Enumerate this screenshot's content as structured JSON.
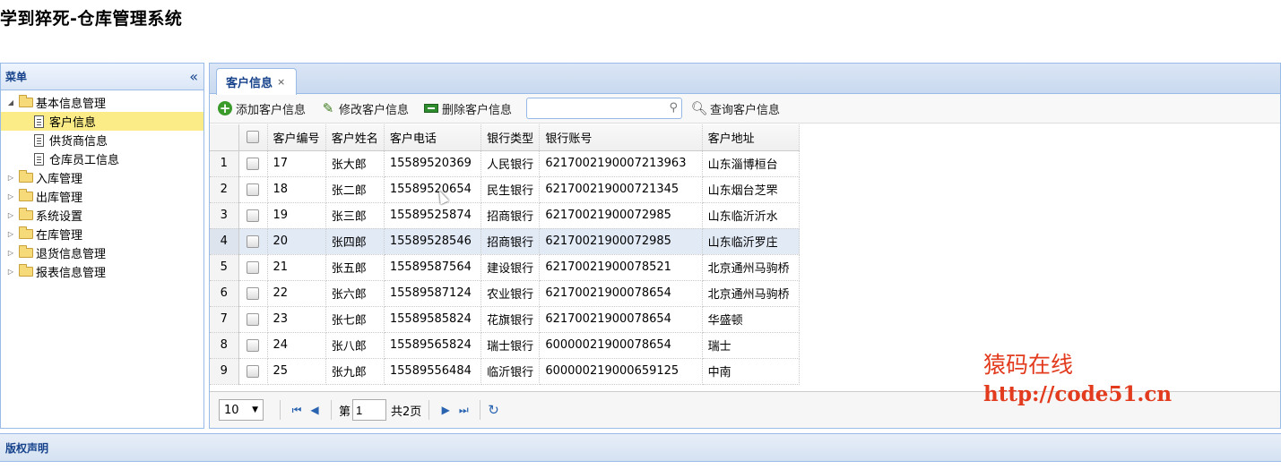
{
  "app": {
    "title": "学到猝死-仓库管理系统"
  },
  "menu": {
    "title": "菜单",
    "collapse_icon": "«",
    "items": [
      {
        "label": "基本信息管理",
        "type": "folder",
        "expanded": true,
        "level": 0
      },
      {
        "label": "客户信息",
        "type": "file",
        "selected": true,
        "level": 1
      },
      {
        "label": "供货商信息",
        "type": "file",
        "level": 1
      },
      {
        "label": "仓库员工信息",
        "type": "file",
        "level": 1
      },
      {
        "label": "入库管理",
        "type": "folder",
        "level": 0
      },
      {
        "label": "出库管理",
        "type": "folder",
        "level": 0
      },
      {
        "label": "系统设置",
        "type": "folder",
        "level": 0
      },
      {
        "label": "在库管理",
        "type": "folder",
        "level": 0
      },
      {
        "label": "退货信息管理",
        "type": "folder",
        "level": 0
      },
      {
        "label": "报表信息管理",
        "type": "folder",
        "level": 0
      }
    ]
  },
  "tab": {
    "label": "客户信息",
    "close": "×"
  },
  "toolbar": {
    "add_label": "添加客户信息",
    "edit_label": "修改客户信息",
    "delete_label": "删除客户信息",
    "search_placeholder": "",
    "query_label": "查询客户信息"
  },
  "grid": {
    "columns": [
      "客户编号",
      "客户姓名",
      "客户电话",
      "银行类型",
      "银行账号",
      "客户地址"
    ],
    "rows": [
      {
        "num": "1",
        "id": "17",
        "name": "张大郎",
        "phone": "15589520369",
        "bank": "人民银行",
        "account": "6217002190007213963",
        "address": "山东淄博桓台"
      },
      {
        "num": "2",
        "id": "18",
        "name": "张二郎",
        "phone": "15589520654",
        "bank": "民生银行",
        "account": "621700219000721345",
        "address": "山东烟台芝罘"
      },
      {
        "num": "3",
        "id": "19",
        "name": "张三郎",
        "phone": "15589525874",
        "bank": "招商银行",
        "account": "62170021900072985",
        "address": "山东临沂沂水"
      },
      {
        "num": "4",
        "id": "20",
        "name": "张四郎",
        "phone": "15589528546",
        "bank": "招商银行",
        "account": "62170021900072985",
        "address": "山东临沂罗庄"
      },
      {
        "num": "5",
        "id": "21",
        "name": "张五郎",
        "phone": "15589587564",
        "bank": "建设银行",
        "account": "62170021900078521",
        "address": "北京通州马驹桥"
      },
      {
        "num": "6",
        "id": "22",
        "name": "张六郎",
        "phone": "15589587124",
        "bank": "农业银行",
        "account": "62170021900078654",
        "address": "北京通州马驹桥"
      },
      {
        "num": "7",
        "id": "23",
        "name": "张七郎",
        "phone": "15589585824",
        "bank": "花旗银行",
        "account": "62170021900078654",
        "address": "华盛顿"
      },
      {
        "num": "8",
        "id": "24",
        "name": "张八郎",
        "phone": "15589565824",
        "bank": "瑞士银行",
        "account": "60000021900078654",
        "address": "瑞士"
      },
      {
        "num": "9",
        "id": "25",
        "name": "张九郎",
        "phone": "15589556484",
        "bank": "临沂银行",
        "account": "600000219000659125",
        "address": "中南"
      }
    ]
  },
  "pager": {
    "page_size": "10",
    "page_prefix": "第",
    "current_page": "1",
    "total_pages_text": "共2页"
  },
  "watermark": {
    "line1": "猿码在线",
    "line2": "http://code51.cn"
  },
  "footer": {
    "label": "版权声明"
  }
}
